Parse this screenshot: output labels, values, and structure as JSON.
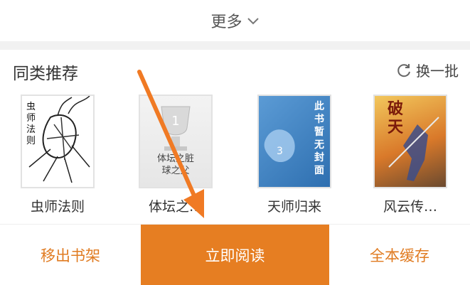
{
  "more": {
    "label": "更多"
  },
  "recommend": {
    "title": "同类推荐",
    "refresh_label": "换一批",
    "books": [
      {
        "title": "虫师法则",
        "cover_text": [
          "虫",
          "师",
          "法",
          "则"
        ]
      },
      {
        "title": "体坛之…",
        "cover_text": [
          "体坛之脏",
          "球之父"
        ]
      },
      {
        "title": "天师归来",
        "cover_text": [
          "此",
          "书",
          "暂",
          "无",
          "封",
          "面"
        ]
      },
      {
        "title": "风云传…",
        "cover_text": [
          "破",
          "天"
        ]
      }
    ]
  },
  "actions": {
    "remove_shelf": "移出书架",
    "read_now": "立即阅读",
    "cache_all": "全本缓存"
  },
  "colors": {
    "accent": "#e67e22",
    "accent_text": "#e07b21"
  }
}
